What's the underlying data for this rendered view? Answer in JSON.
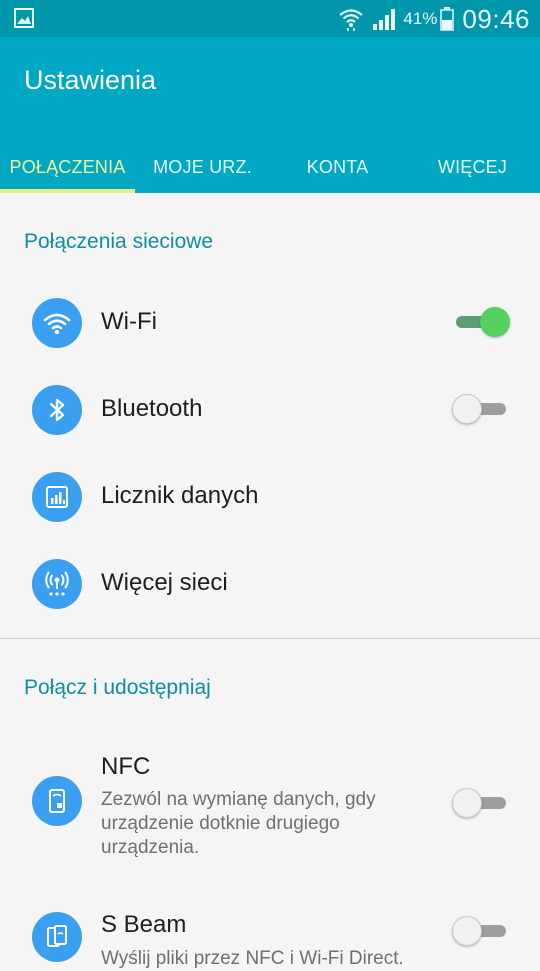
{
  "status_bar": {
    "battery_percent": "41%",
    "time": "09:46",
    "icons": [
      "image-notification-icon",
      "wifi-status-icon",
      "signal-icon",
      "battery-icon"
    ]
  },
  "app": {
    "title": "Ustawienia"
  },
  "tabs": [
    {
      "label": "POŁĄCZENIA",
      "selected": true
    },
    {
      "label": "MOJE URZ.",
      "selected": false
    },
    {
      "label": "KONTA",
      "selected": false
    },
    {
      "label": "WIĘCEJ",
      "selected": false
    }
  ],
  "sections": [
    {
      "header": "Połączenia sieciowe",
      "items": [
        {
          "label": "Wi-Fi",
          "icon": "wifi-icon",
          "toggle": true,
          "toggle_on": true
        },
        {
          "label": "Bluetooth",
          "icon": "bluetooth-icon",
          "toggle": true,
          "toggle_on": false
        },
        {
          "label": "Licznik danych",
          "icon": "data-usage-icon",
          "toggle": false
        },
        {
          "label": "Więcej sieci",
          "icon": "more-networks-icon",
          "toggle": false
        }
      ]
    },
    {
      "header": "Połącz i udostępniaj",
      "items": [
        {
          "label": "NFC",
          "subtitle": "Zezwól na wymianę danych, gdy urządzenie dotknie drugiego urządzenia.",
          "icon": "nfc-icon",
          "toggle": true,
          "toggle_on": false
        },
        {
          "label": "S Beam",
          "subtitle": "Wyślij pliki przez NFC i Wi-Fi Direct.",
          "icon": "s-beam-icon",
          "toggle": true,
          "toggle_on": false
        }
      ]
    }
  ],
  "colors": {
    "status_bar": "#0097ad",
    "app_bar": "#00a8c3",
    "tab_active": "#f3f19a",
    "section_header": "#0f8ea0",
    "row_icon": "#3b9ff1",
    "toggle_on": "#53d05f"
  }
}
